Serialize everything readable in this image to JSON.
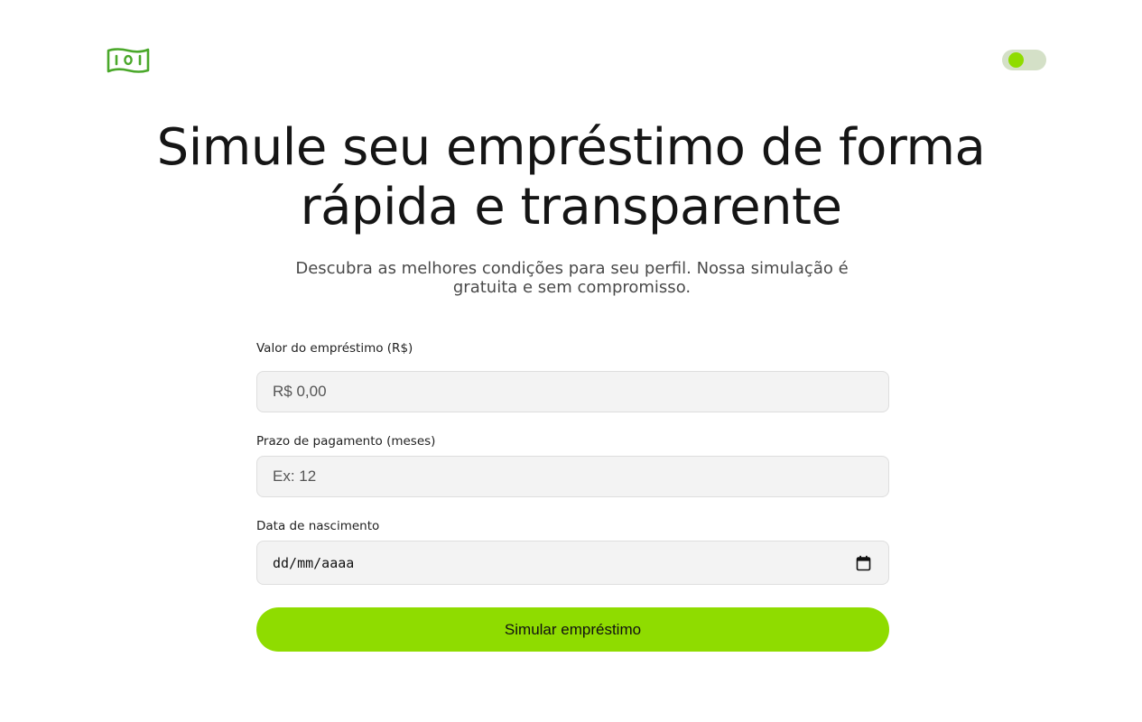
{
  "header": {
    "logo_icon": "money-bill-icon",
    "theme_toggle_icon": "toggle-switch-icon"
  },
  "hero": {
    "title_line1": "Simule seu empréstimo de forma",
    "title_line2": "rápida e transparente",
    "subtitle": "Descubra as melhores condições para seu perfil. Nossa simulação é gratuita e sem compromisso."
  },
  "form": {
    "amount": {
      "label": "Valor do empréstimo (R$)",
      "placeholder": "R$ 0,00",
      "value": ""
    },
    "term": {
      "label": "Prazo de pagamento (meses)",
      "placeholder": "Ex: 12",
      "value": ""
    },
    "birthdate": {
      "label": "Data de nascimento",
      "display_format": "dd/mm/aaaa",
      "icon": "calendar-icon"
    },
    "submit_label": "Simular empréstimo"
  },
  "colors": {
    "accent": "#8fdc00",
    "logo_green": "#4aa82a",
    "toggle_track": "#d4e0c7",
    "input_background": "#f3f3f3",
    "text_primary": "#151515"
  }
}
